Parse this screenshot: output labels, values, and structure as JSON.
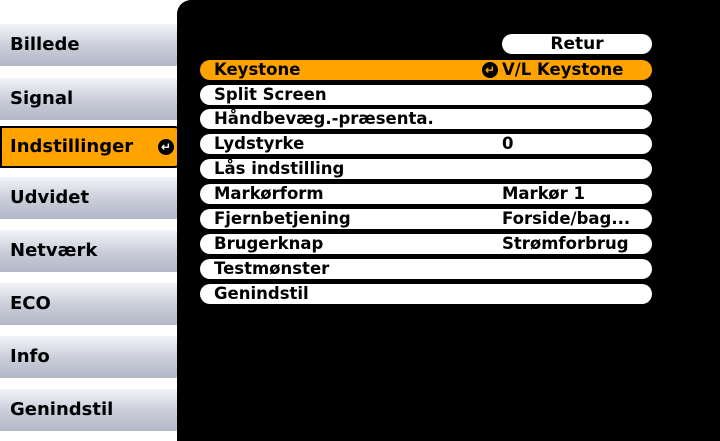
{
  "tabs": [
    {
      "label": "Billede"
    },
    {
      "label": "Signal"
    },
    {
      "label": "Indstillinger",
      "enter_icon": "↵"
    },
    {
      "label": "Udvidet"
    },
    {
      "label": "Netværk"
    },
    {
      "label": "ECO"
    },
    {
      "label": "Info"
    },
    {
      "label": "Genindstil"
    }
  ],
  "selected_tab_index": 2,
  "menu": {
    "return_label": "Retur",
    "items": [
      {
        "label": "Keystone",
        "value": "V/L Keystone",
        "value_icon": "↵"
      },
      {
        "label": "Split Screen",
        "value": ""
      },
      {
        "label": "Håndbevæg.-præsenta.",
        "value": ""
      },
      {
        "label": "Lydstyrke",
        "value": "0"
      },
      {
        "label": "Lås indstilling",
        "value": ""
      },
      {
        "label": "Markørform",
        "value": "Markør 1"
      },
      {
        "label": "Fjernbetjening",
        "value": "Forside/bag..."
      },
      {
        "label": "Brugerknap",
        "value": "Strømforbrug"
      },
      {
        "label": "Testmønster",
        "value": ""
      },
      {
        "label": "Genindstil",
        "value": ""
      }
    ],
    "selected_item_index": 0
  },
  "colors": {
    "accent": "#ffa300",
    "panel_background": "#000000",
    "row_background": "#ffffff",
    "tab_background": "#c9ccd8"
  }
}
